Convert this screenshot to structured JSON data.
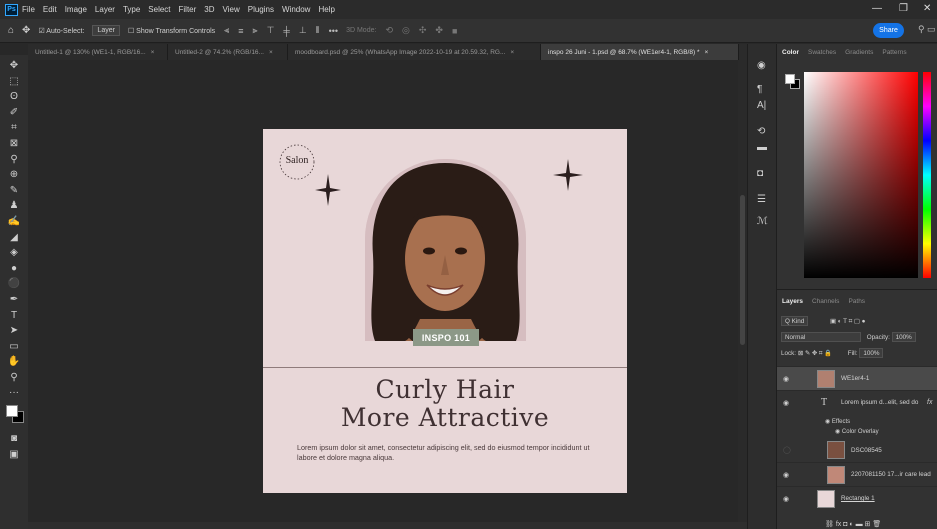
{
  "app": {
    "logo": "Ps"
  },
  "menu": [
    "File",
    "Edit",
    "Image",
    "Layer",
    "Type",
    "Select",
    "Filter",
    "3D",
    "View",
    "Plugins",
    "Window",
    "Help"
  ],
  "options_bar": {
    "auto_select_label": "Auto-Select:",
    "auto_select_value": "Layer",
    "transform_label": "Show Transform Controls",
    "mode_3d_label": "3D Mode:",
    "share_label": "Share"
  },
  "tabs": [
    {
      "label": "Untitled-1 @ 130% (WE1-1, RGB/16...",
      "active": false
    },
    {
      "label": "Untitled-2 @ 74.2% (RGB/16...",
      "active": false
    },
    {
      "label": "moodboard.psd @ 25% (WhatsApp Image 2022-10-19 at 20.59.32, RG...",
      "active": false
    },
    {
      "label": "inspo 26 Juni - 1.psd @ 68.7% (WE1er4-1, RGB/8) *",
      "active": true
    }
  ],
  "artboard": {
    "logo_text": "Salon",
    "badge": "INSPO 101",
    "headline_1": "Curly Hair",
    "headline_2": "More Attractive",
    "body": "Lorem ipsum dolor sit amet, consectetur adipiscing elit, sed do eiusmod tempor incididunt ut labore et dolore magna aliqua.",
    "colors": {
      "background": "#e8d7d8",
      "badge": "#8c9887",
      "text": "#3f3032"
    }
  },
  "color_panel": {
    "tabs": [
      "Color",
      "Swatches",
      "Gradients",
      "Patterns"
    ],
    "active_tab": "Color"
  },
  "layers_panel": {
    "tabs": [
      "Layers",
      "Channels",
      "Paths"
    ],
    "active_tab": "Layers",
    "filter_label": "Q Kind",
    "blend_mode": "Normal",
    "opacity_label": "Opacity:",
    "opacity_value": "100%",
    "lock_label": "Lock:",
    "fill_label": "Fill:",
    "fill_value": "100%",
    "layers": [
      {
        "name": "WE1er4-1",
        "selected": true
      },
      {
        "name": "Lorem ipsum d...elit, sed do",
        "fx": "fx"
      },
      {
        "name": "Effects"
      },
      {
        "name": "Color Overlay"
      },
      {
        "name": "DSC08545"
      },
      {
        "name": "2207081150 17...ir care lead"
      },
      {
        "name": "Rectangle 1"
      }
    ]
  }
}
